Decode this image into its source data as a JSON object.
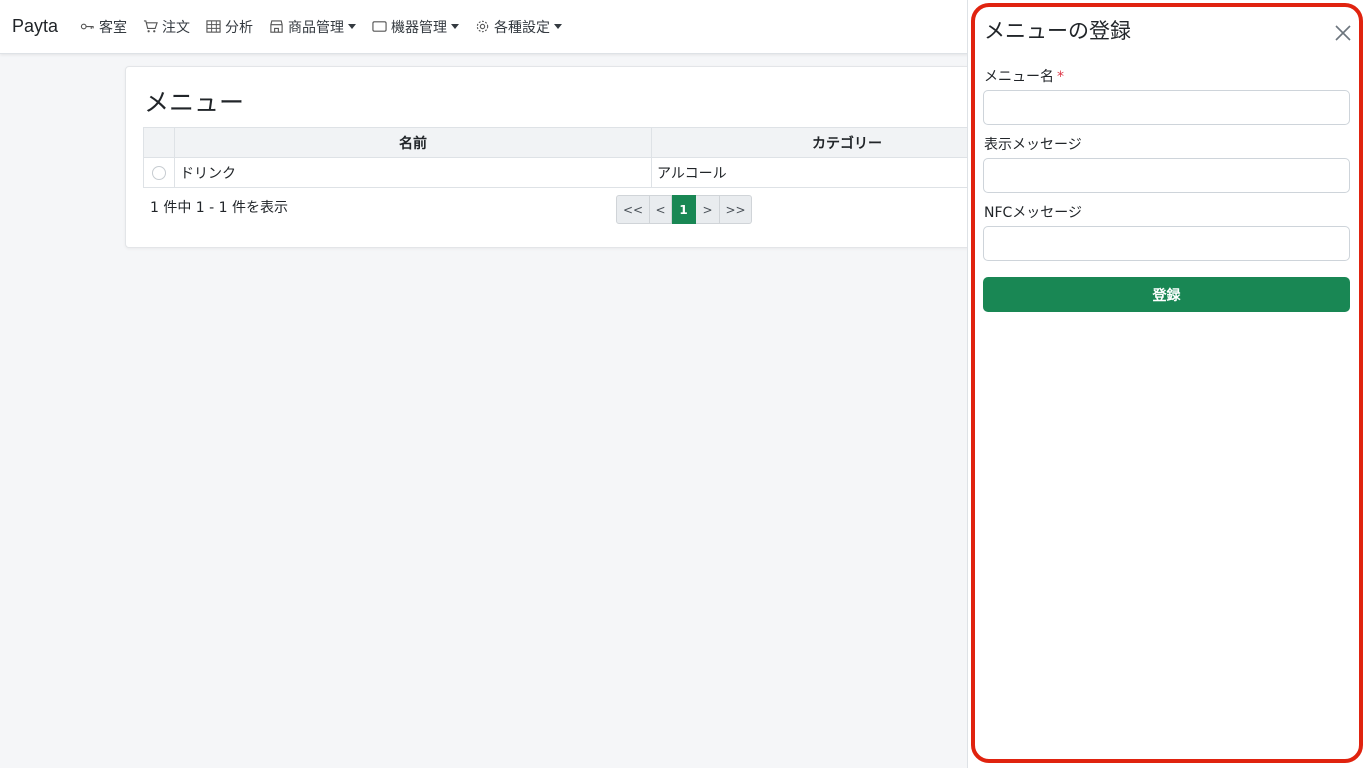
{
  "navbar": {
    "brand": "Payta",
    "items": [
      {
        "label": "客室",
        "icon": "key-icon",
        "dropdown": false
      },
      {
        "label": "注文",
        "icon": "cart-icon",
        "dropdown": false
      },
      {
        "label": "分析",
        "icon": "table-icon",
        "dropdown": false
      },
      {
        "label": "商品管理",
        "icon": "shop-icon",
        "dropdown": true
      },
      {
        "label": "機器管理",
        "icon": "device-icon",
        "dropdown": true
      },
      {
        "label": "各種設定",
        "icon": "gear-icon",
        "dropdown": true
      }
    ]
  },
  "main": {
    "title": "メニュー",
    "table": {
      "columns": [
        "",
        "名前",
        "カテゴリー"
      ],
      "rows": [
        {
          "name": "ドリンク",
          "category": "アルコール"
        }
      ]
    },
    "count_text": "1 件中 1 - 1 件を表示",
    "pagination": {
      "first": "<<",
      "prev": "<",
      "current": "1",
      "next": ">",
      "last": ">>"
    }
  },
  "panel": {
    "title": "メニューの登録",
    "fields": [
      {
        "label": "メニュー名",
        "required": true,
        "value": "",
        "placeholder": ""
      },
      {
        "label": "表示メッセージ",
        "required": false,
        "value": "",
        "placeholder": ""
      },
      {
        "label": "NFCメッセージ",
        "required": false,
        "value": "",
        "placeholder": ""
      }
    ],
    "required_mark": "*",
    "submit_label": "登録"
  },
  "colors": {
    "accent": "#198754",
    "highlight_border": "#e0230f",
    "required": "#dc3545"
  }
}
